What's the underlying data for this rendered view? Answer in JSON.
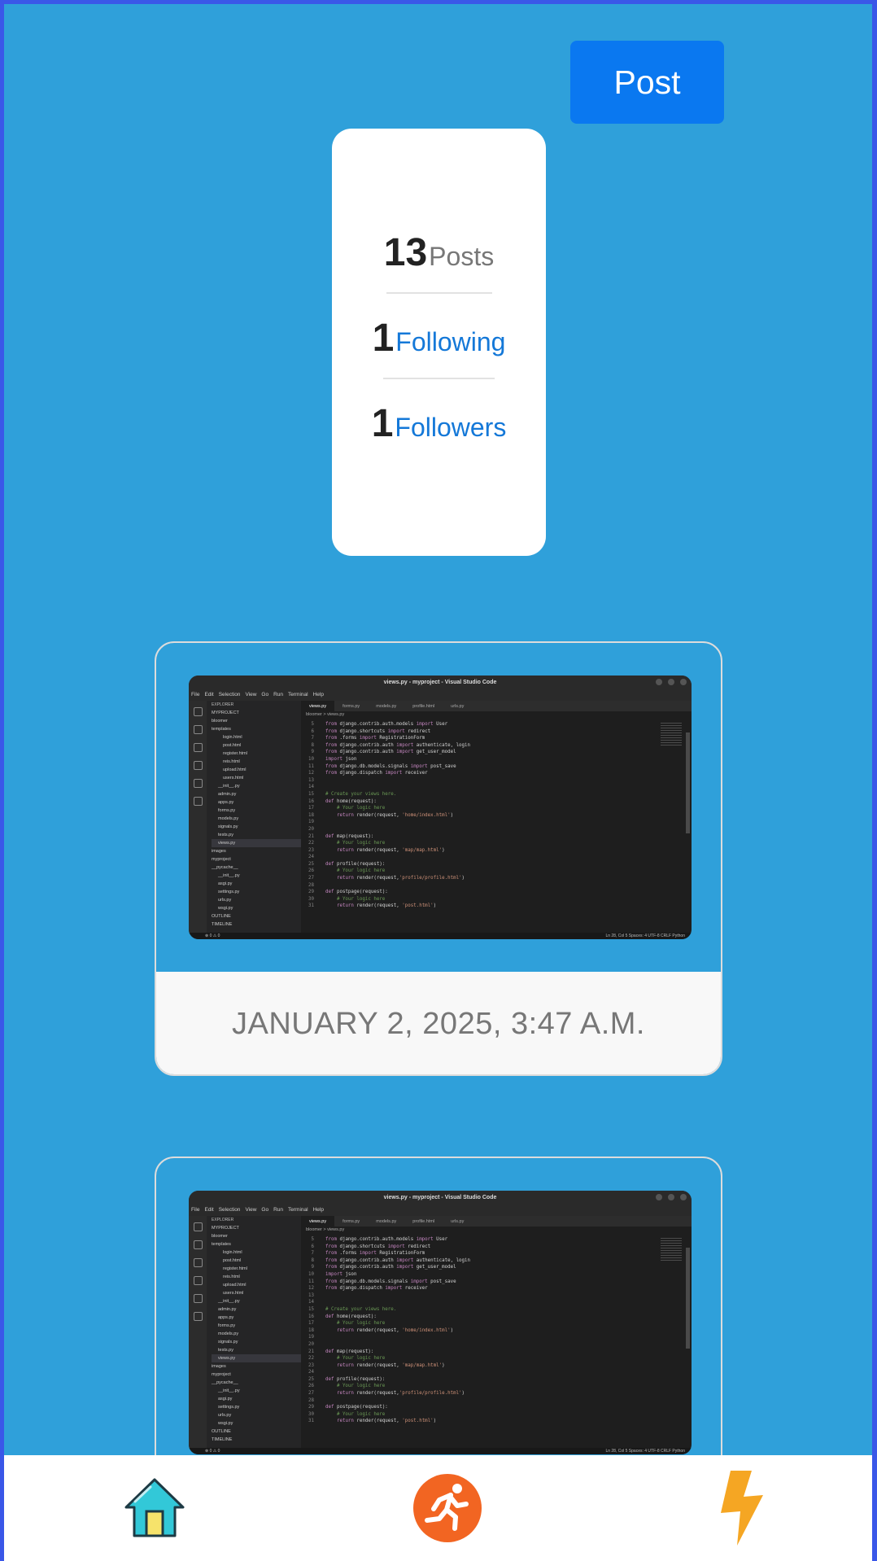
{
  "header": {
    "post_button": "Post"
  },
  "stats": {
    "posts": {
      "count": "13",
      "label": "Posts"
    },
    "following": {
      "count": "1",
      "label": "Following"
    },
    "followers": {
      "count": "1",
      "label": "Followers"
    }
  },
  "posts": [
    {
      "date": "JANUARY 2, 2025, 3:47 A.M."
    },
    {
      "date": ""
    }
  ],
  "screenshot": {
    "title": "views.py - myproject - Visual Studio Code",
    "menu": [
      "File",
      "Edit",
      "Selection",
      "View",
      "Go",
      "Run",
      "Terminal",
      "Help"
    ],
    "tabs": [
      "views.py",
      "forms.py",
      "models.py",
      "profile.html",
      "urls.py"
    ],
    "breadcrumb": "bloomer > views.py",
    "explorer_title": "EXPLORER",
    "explorer_items": [
      "MYPROJECT",
      "bloomer",
      "templates",
      "login.html",
      "post.html",
      "register.html",
      "reis.html",
      "upload.html",
      "users.html",
      "__init__.py",
      "admin.py",
      "apps.py",
      "forms.py",
      "models.py",
      "signals.py",
      "tests.py",
      "views.py",
      "images",
      "myproject",
      "__pycache__",
      "__init__.py",
      "asgi.py",
      "settings.py",
      "urls.py",
      "wsgi.py",
      "OUTLINE",
      "TIMELINE"
    ],
    "code": [
      "from django.contrib.auth.models import User",
      "from django.shortcuts import redirect",
      "from .forms import RegistrationForm",
      "from django.contrib.auth import authenticate, login",
      "from django.contrib.auth import get_user_model",
      "import json",
      "from django.db.models.signals import post_save",
      "from django.dispatch import receiver",
      "",
      "",
      "# Create your views here.",
      "def home(request):",
      "    # Your logic here",
      "    return render(request, 'home/index.html')",
      "",
      "",
      "def map(request):",
      "    # Your logic here",
      "    return render(request, 'map/map.html')",
      "",
      "def profile(request):",
      "    # Your logic here",
      "    return render(request,'profile/profile.html')",
      "",
      "def postpage(request):",
      "    # Your logic here",
      "    return render(request, 'post.html')"
    ],
    "status_left": "⊗ 0 ⚠ 0",
    "status_right": "Ln 28, Col 5   Spaces: 4   UTF-8   CRLF   Python"
  },
  "nav": [
    {
      "icon": "home-icon"
    },
    {
      "icon": "running-icon"
    },
    {
      "icon": "lightning-icon"
    }
  ],
  "colors": {
    "background": "#2fa0da",
    "accent": "#0a78f0",
    "link": "#1478d8",
    "frame": "#3a57e8",
    "running": "#f26522",
    "lightning": "#f5a623"
  }
}
